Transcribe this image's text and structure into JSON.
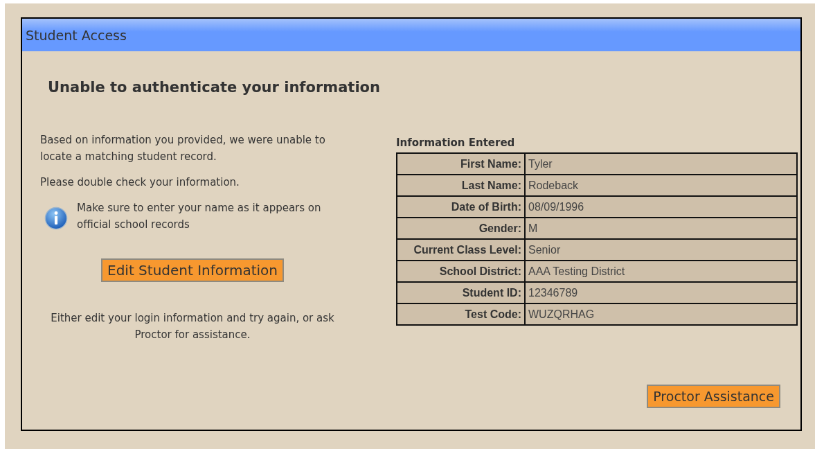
{
  "window": {
    "title": "Student Access"
  },
  "heading": "Unable to authenticate your information",
  "message": [
    "Based on information you provided, we were unable to locate a matching student record.",
    "Please double check your information."
  ],
  "info_note": "Make sure to enter your name as it appears on official school records",
  "edit_button": "Edit Student Information",
  "footer_note": "Either edit your login information and try again, or ask Proctor for assistance.",
  "info_table": {
    "title": "Information Entered",
    "rows": [
      {
        "label": "First Name:",
        "value": "Tyler"
      },
      {
        "label": "Last Name:",
        "value": "Rodeback"
      },
      {
        "label": "Date of Birth:",
        "value": "08/09/1996"
      },
      {
        "label": "Gender:",
        "value": "M"
      },
      {
        "label": "Current Class Level:",
        "value": "Senior"
      },
      {
        "label": "School District:",
        "value": "AAA Testing District"
      },
      {
        "label": "Student ID:",
        "value": "12346789"
      },
      {
        "label": "Test Code:",
        "value": "WUZQRHAG"
      }
    ]
  },
  "proctor_button": "Proctor Assistance"
}
